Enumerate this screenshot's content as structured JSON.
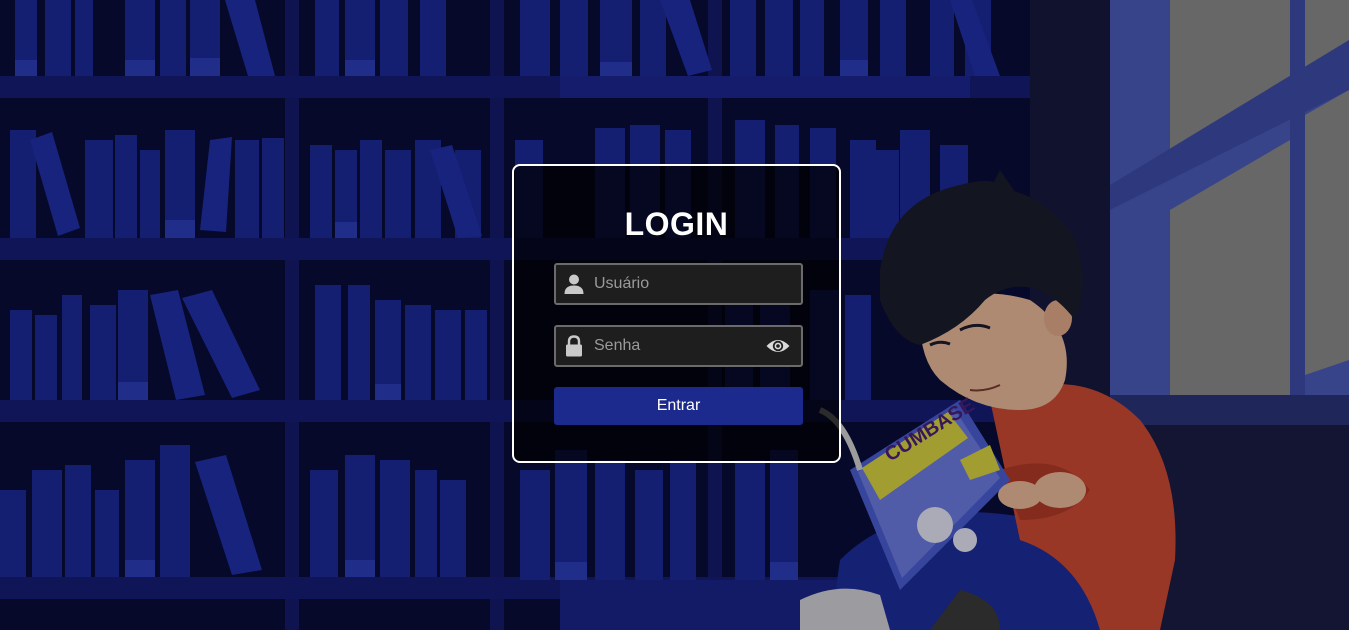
{
  "login": {
    "title": "LOGIN",
    "username_placeholder": "Usuário",
    "password_placeholder": "Senha",
    "submit_label": "Entrar"
  },
  "icons": {
    "username": "user-icon",
    "password": "lock-icon",
    "toggle_password": "eye-icon"
  },
  "illustration": {
    "description_text": "",
    "comic_cover_text": "CUMBASE"
  },
  "colors": {
    "background": "#0a0e3a",
    "button": "#1b2a8c",
    "card_border": "#ffffff"
  }
}
